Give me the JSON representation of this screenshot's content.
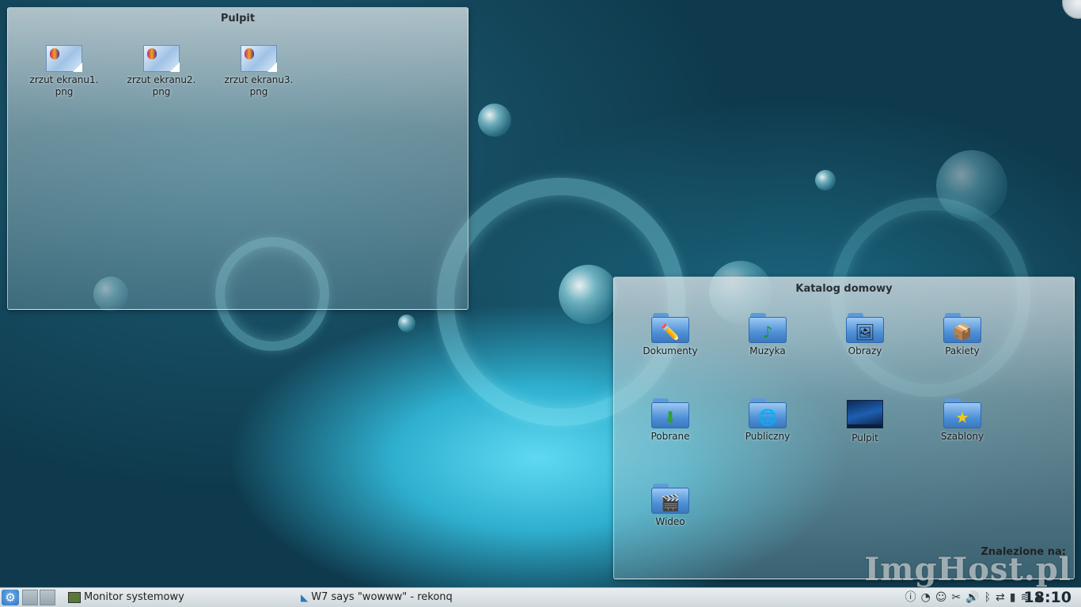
{
  "desktop_folder": {
    "title": "Pulpit",
    "items": [
      {
        "label": "zrzut ekranu1.\npng",
        "line1": "zrzut ekranu1.",
        "line2": "png"
      },
      {
        "label": "zrzut ekranu2.\npng",
        "line1": "zrzut ekranu2.",
        "line2": "png"
      },
      {
        "label": "zrzut ekranu3.\npng",
        "line1": "zrzut ekranu3.",
        "line2": "png"
      }
    ]
  },
  "home_folder": {
    "title": "Katalog domowy",
    "items": [
      {
        "label": "Dokumenty",
        "icon": "pencil-icon"
      },
      {
        "label": "Muzyka",
        "icon": "music-note-icon"
      },
      {
        "label": "Obrazy",
        "icon": "pictures-icon"
      },
      {
        "label": "Pakiety",
        "icon": "package-icon"
      },
      {
        "label": "Pobrane",
        "icon": "download-arrow-icon"
      },
      {
        "label": "Publiczny",
        "icon": "globe-icon"
      },
      {
        "label": "Pulpit",
        "icon": "desktop-icon"
      },
      {
        "label": "Szablony",
        "icon": "star-icon"
      },
      {
        "label": "Wideo",
        "icon": "clapperboard-icon"
      }
    ],
    "found_label": "Znalezione na:"
  },
  "taskbar": {
    "tasks": [
      {
        "label": "Monitor systemowy",
        "icon": "system-monitor-icon"
      },
      {
        "label": "W7 says \"wowww\" - rekonq",
        "icon": "rekonq-icon"
      }
    ],
    "tray_icons": [
      "info-icon",
      "network-icon",
      "updates-icon",
      "clipboard-scissors-icon",
      "volume-icon",
      "bluetooth-icon",
      "usb-icon",
      "battery-icon",
      "wifi-icon",
      "expand-arrow-icon"
    ],
    "clock": "18:10"
  },
  "watermark": "ImgHost.pl",
  "colors": {
    "accent": "#2f75c5",
    "taskbar_bg": "#d9e1e4"
  }
}
